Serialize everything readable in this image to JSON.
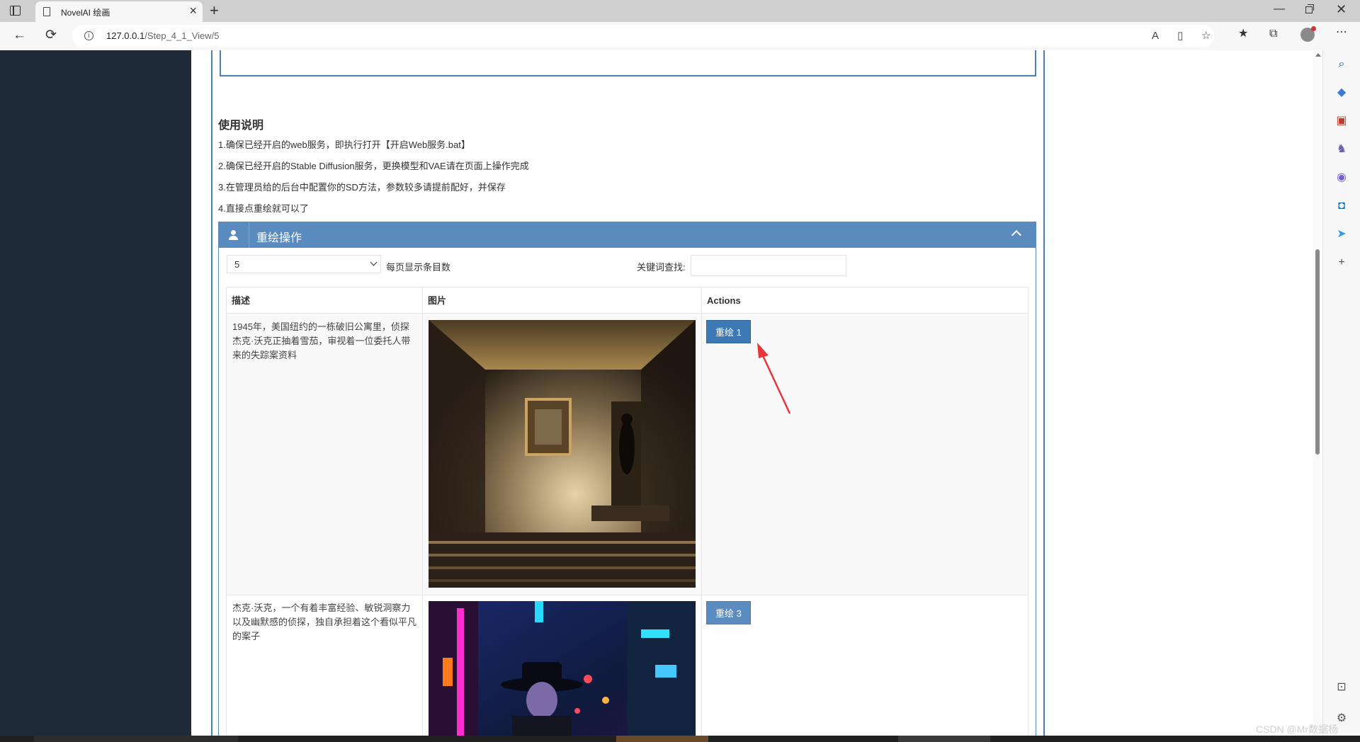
{
  "browser": {
    "tab_title": "NovelAI 绘画",
    "url_host": "127.0.0.1",
    "url_path": "/Step_4_1_View/5"
  },
  "usage": {
    "title": "使用说明",
    "lines": [
      "1.确保已经开启的web服务，即执行打开【开启Web服务.bat】",
      "2.确保已经开启的Stable Diffusion服务，更换模型和VAE请在页面上操作完成",
      "3.在管理员给的后台中配置你的SD方法，参数较多请提前配好，并保存",
      "4.直接点重绘就可以了"
    ]
  },
  "panel": {
    "title": "重绘操作",
    "page_size_value": "5",
    "page_size_label": "每页显示条目数",
    "search_label": "关键词查找:",
    "search_value": ""
  },
  "table": {
    "headers": [
      "描述",
      "图片",
      "Actions"
    ],
    "rows": [
      {
        "desc": "1945年，美国纽约的一栋破旧公寓里，侦探杰克·沃克正抽着雪茄，审视着一位委托人带来的失踪案资料",
        "image": "noir-hallway-image",
        "action": "重绘 1"
      },
      {
        "desc": "杰克·沃克，一个有着丰富经验、敏锐洞察力以及幽默感的侦探，独自承担着这个看似平凡的案子",
        "image": "neon-street-detective-image",
        "action": "重绘 3"
      }
    ]
  },
  "watermark": "CSDN @Mr数据杨",
  "colors": {
    "panel_header": "#5a8bbf",
    "button": "#3d79b5",
    "left_rail": "#1f2b38",
    "annotation_arrow": "#e8353a"
  }
}
